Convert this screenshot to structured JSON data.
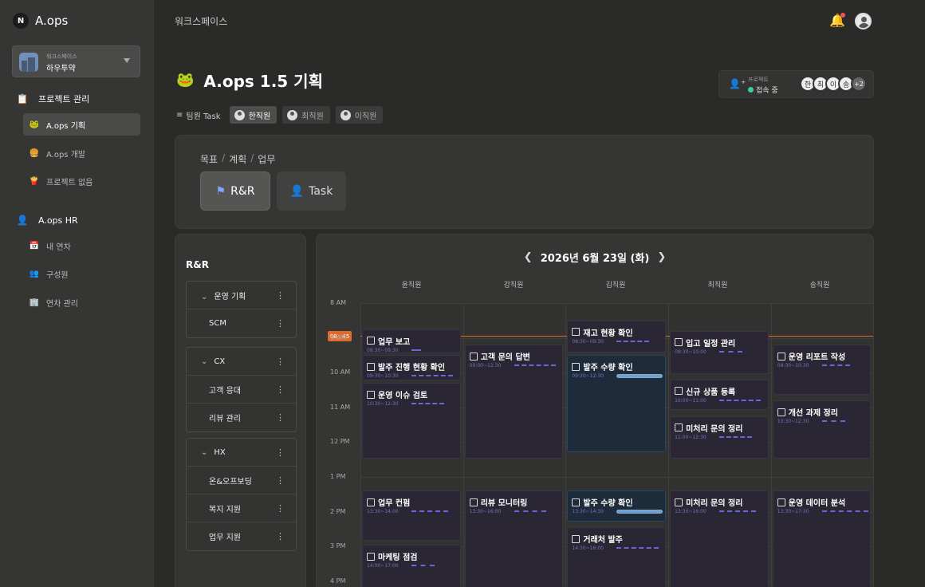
{
  "sidebar": {
    "brand": {
      "logo": "N",
      "name": "A.ops"
    },
    "workspace": {
      "label": "워크스페이스",
      "name": "하우투약"
    },
    "groups": [
      {
        "icon": "calendar-board-icon",
        "label": "프로젝트 관리"
      },
      {
        "icon": "person-icon",
        "label": "A.ops HR"
      }
    ],
    "project_items": [
      {
        "icon": "frog-icon",
        "label": "A.ops 기획"
      },
      {
        "icon": "burger-icon",
        "label": "A.ops 개발"
      },
      {
        "icon": "fries-icon",
        "label": "프로젝트 없음"
      }
    ],
    "hr_items": [
      {
        "icon": "calendar-icon",
        "label": "내 연차"
      },
      {
        "icon": "people-icon",
        "label": "구성원"
      },
      {
        "icon": "building-icon",
        "label": "연차 관리"
      }
    ]
  },
  "topbar": {
    "title": "워크스페이스"
  },
  "project": {
    "emoji": "🐸",
    "title": "A.ops 1.5 기획"
  },
  "presence": {
    "label": "프로젝트",
    "status": "접속 중",
    "avatars": [
      "한",
      "최",
      "이",
      "송"
    ],
    "more": "+2"
  },
  "filter": {
    "label": "팀원 Task",
    "chips": [
      "한직원",
      "최직원",
      "이직원"
    ]
  },
  "goal": {
    "crumbs": [
      "목표",
      "/",
      "계획",
      "/",
      "업무"
    ],
    "buttons": [
      {
        "icon": "flag-icon",
        "label": "R&R"
      },
      {
        "icon": "person-icon",
        "label": "Task"
      }
    ]
  },
  "rr": {
    "title": "R&R",
    "groups": [
      {
        "name": "운영 기획",
        "items": [
          "SCM"
        ]
      },
      {
        "name": "CX",
        "items": [
          "고객 응대",
          "리뷰 관리"
        ]
      },
      {
        "name": "HX",
        "items": [
          "온&오프보딩",
          "복지 지원",
          "업무 지원"
        ]
      }
    ]
  },
  "calendar": {
    "date": "2026년 6월 23일 (화)",
    "members": [
      "윤직원",
      "강직원",
      "김직원",
      "최직원",
      "송직원"
    ],
    "hours": [
      "8 AM",
      "9 AM",
      "10 AM",
      "11 AM",
      "12 PM",
      "1 PM",
      "2 PM",
      "3 PM",
      "4 PM"
    ],
    "now": "08 : 45",
    "events": [
      {
        "col": 0,
        "title": "업무 보고",
        "time": "08:30~09:30",
        "start": 8.75,
        "end": 9.5,
        "progress": 0.2
      },
      {
        "col": 0,
        "title": "발주 진행 현황 확인",
        "time": "09:30~10:30",
        "start": 9.5,
        "end": 10.3,
        "progress": 0.9
      },
      {
        "col": 0,
        "title": "운영 이슈 검토",
        "time": "10:30~12:30",
        "start": 10.3,
        "end": 12.55,
        "progress": 0.7
      },
      {
        "col": 0,
        "title": "업무 컨펌",
        "time": "13:30~14:00",
        "start": 13.4,
        "end": 14.9,
        "progress": 0.8
      },
      {
        "col": 0,
        "title": "마케팅 점검",
        "time": "14:00~17:00",
        "start": 14.95,
        "end": 16.5,
        "progress": 0.5
      },
      {
        "col": 1,
        "title": "고객 문의 답변",
        "time": "09:00~12:30",
        "start": 9.2,
        "end": 12.55,
        "progress": 0.9
      },
      {
        "col": 1,
        "title": "리뷰 모니터링",
        "time": "13:30~16:00",
        "start": 13.4,
        "end": 16.5,
        "progress": 0.7
      },
      {
        "col": 2,
        "title": "재고 현황 확인",
        "time": "08:30~09:30",
        "start": 8.5,
        "end": 9.5,
        "progress": 0.7
      },
      {
        "col": 2,
        "title": "발주 수량 확인",
        "time": "09:30~12:30",
        "start": 9.5,
        "end": 12.35,
        "progress": 1.0,
        "highlight": true
      },
      {
        "col": 2,
        "title": "발주 수량 확인",
        "time": "13:30~14:30",
        "start": 13.4,
        "end": 14.35,
        "progress": 1.0,
        "highlight": true
      },
      {
        "col": 2,
        "title": "거래처 발주",
        "time": "14:30~16:00",
        "start": 14.45,
        "end": 16.5,
        "progress": 0.9
      },
      {
        "col": 3,
        "title": "입고 일정 관리",
        "time": "08:30~10:00",
        "start": 8.8,
        "end": 10.1,
        "progress": 0.5
      },
      {
        "col": 3,
        "title": "신규 상품 등록",
        "time": "10:00~11:00",
        "start": 10.2,
        "end": 11.15,
        "progress": 0.9
      },
      {
        "col": 3,
        "title": "미처리 문의 정리",
        "time": "11:00~12:30",
        "start": 11.25,
        "end": 12.55,
        "progress": 0.7
      },
      {
        "col": 3,
        "title": "미처리 문의 정리",
        "time": "13:30~16:00",
        "start": 13.4,
        "end": 16.5,
        "progress": 0.8
      },
      {
        "col": 4,
        "title": "운영 리포트 작성",
        "time": "08:30~10:30",
        "start": 9.2,
        "end": 10.7,
        "progress": 0.6
      },
      {
        "col": 4,
        "title": "개선 과제 정리",
        "time": "10:30~12:30",
        "start": 10.8,
        "end": 12.55,
        "progress": 0.5
      },
      {
        "col": 4,
        "title": "운영 데이터 분석",
        "time": "13:30~17:30",
        "start": 13.4,
        "end": 16.5,
        "progress": 1.0
      }
    ]
  }
}
